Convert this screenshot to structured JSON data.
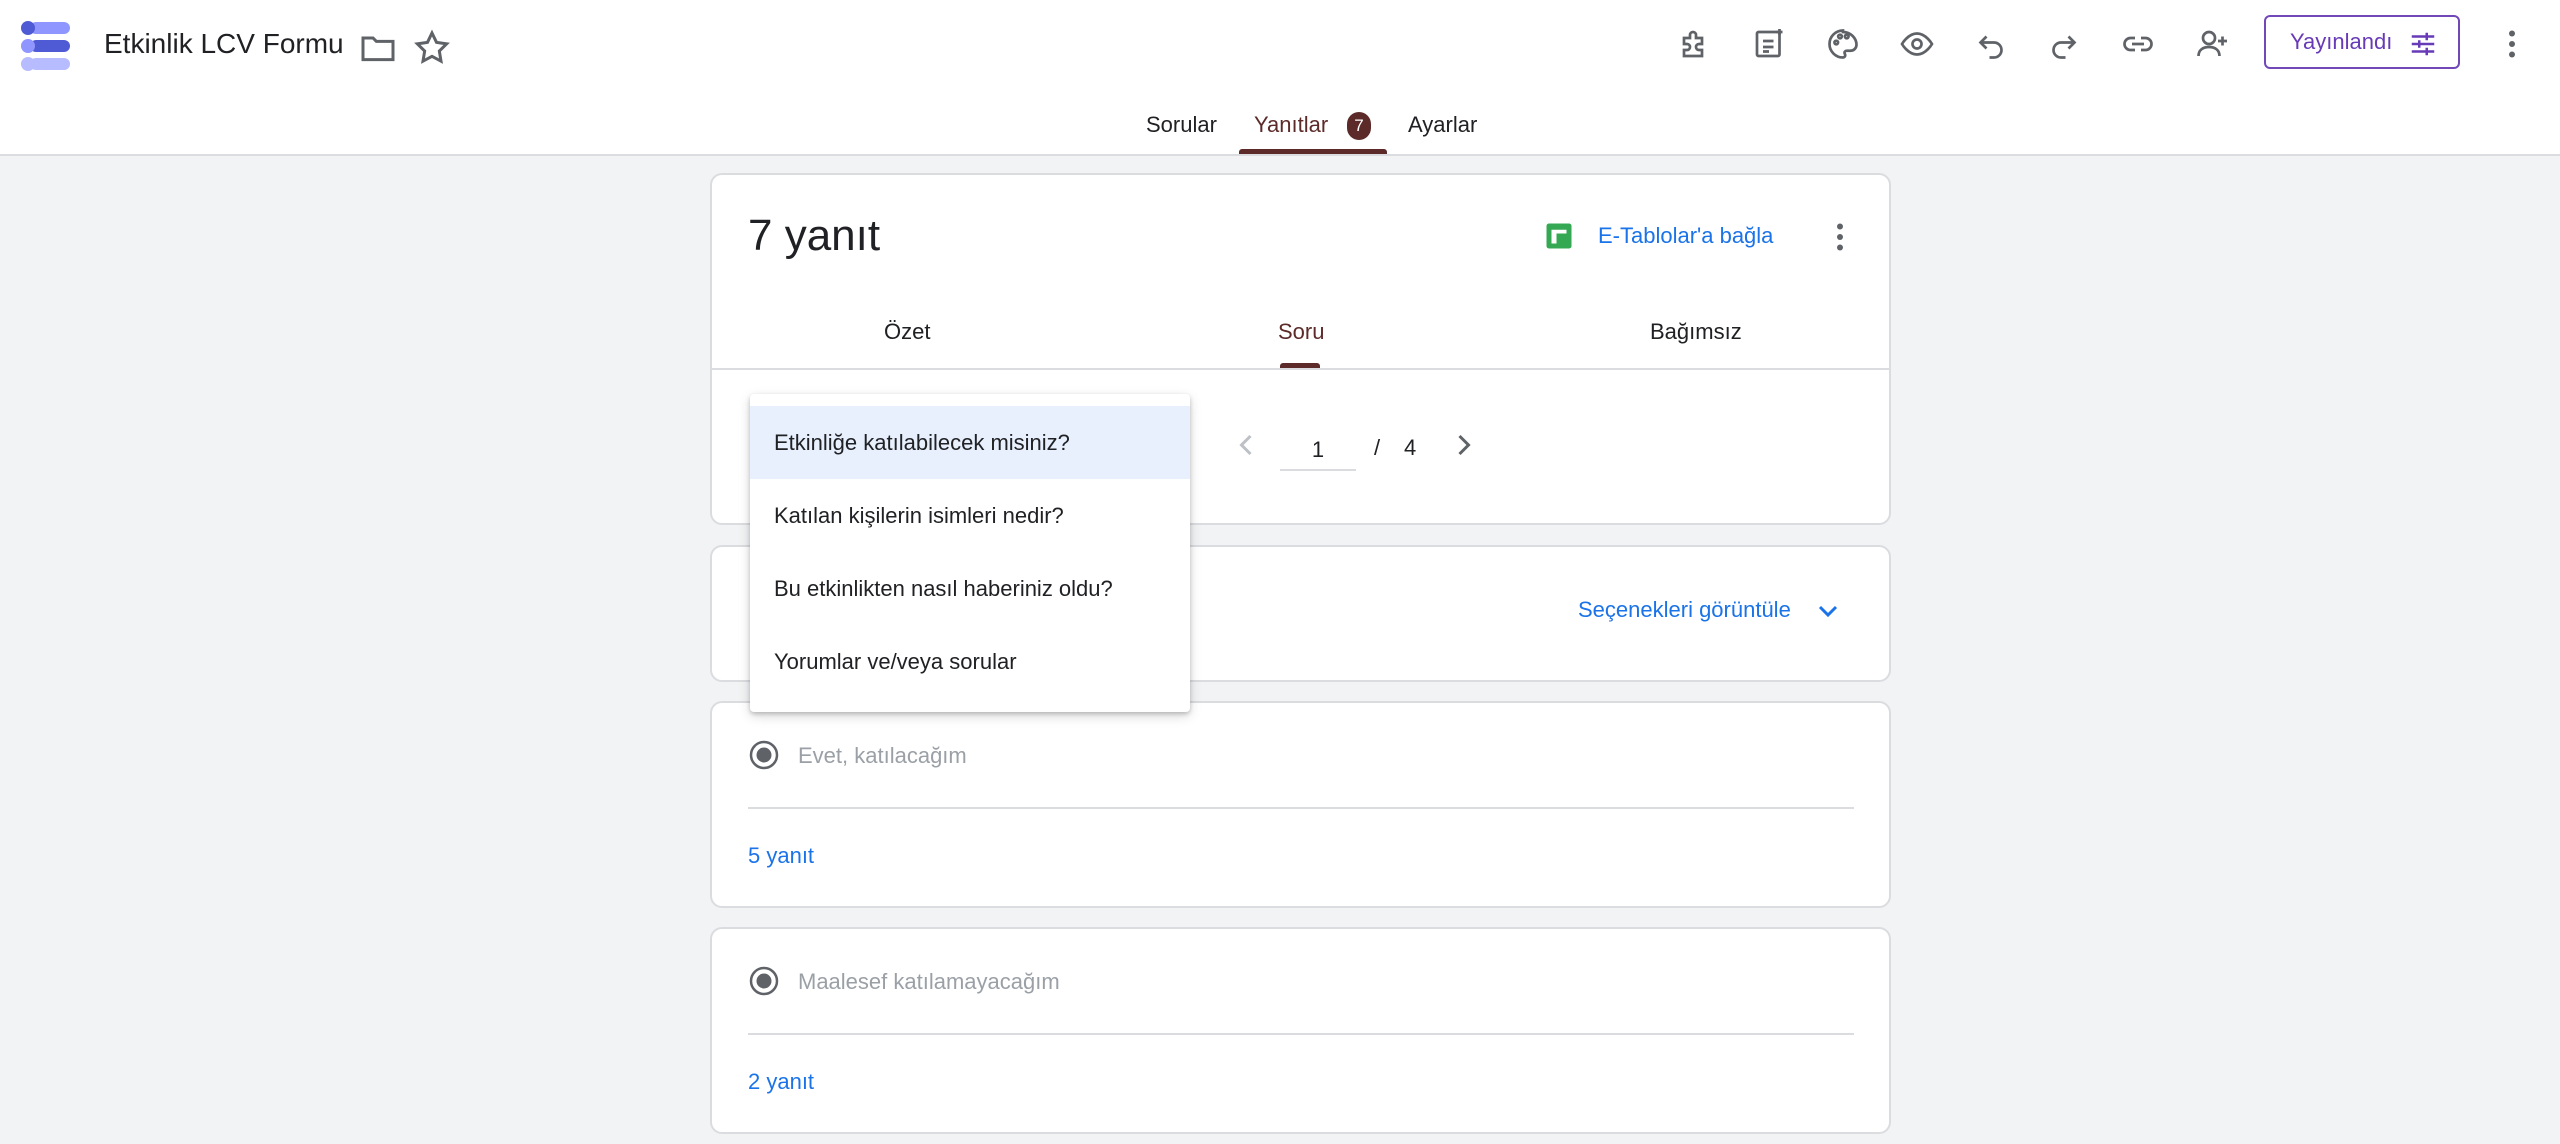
{
  "header": {
    "title": "Etkinlik LCV Formu",
    "publish_label": "Yayınlandı"
  },
  "main_tabs": [
    {
      "label": "Sorular"
    },
    {
      "label": "Yanıtlar",
      "badge": "7"
    },
    {
      "label": "Ayarlar"
    }
  ],
  "summary": {
    "count_label": "7 yanıt",
    "sheets_link": "E-Tablolar'a bağla"
  },
  "sub_tabs": [
    {
      "label": "Özet"
    },
    {
      "label": "Soru"
    },
    {
      "label": "Bağımsız"
    }
  ],
  "pager": {
    "current": "1",
    "separator": "/",
    "total": "4"
  },
  "view_options": "Seçenekleri görüntüle",
  "options": [
    {
      "label": "Evet, katılacağım",
      "count": "5 yanıt"
    },
    {
      "label": "Maalesef katılamayacağım",
      "count": "2 yanıt"
    }
  ],
  "question_dropdown": [
    {
      "label": "Etkinliğe katılabilecek misiniz?",
      "selected": true
    },
    {
      "label": "Katılan kişilerin isimleri nedir?"
    },
    {
      "label": "Bu etkinlikten nasıl haberiniz oldu?"
    },
    {
      "label": "Yorumlar ve/veya sorular"
    }
  ],
  "colors": {
    "accent": "#5c2b29",
    "link": "#1a73e8",
    "publish": "#673ab7",
    "sheets": "#34a853"
  }
}
